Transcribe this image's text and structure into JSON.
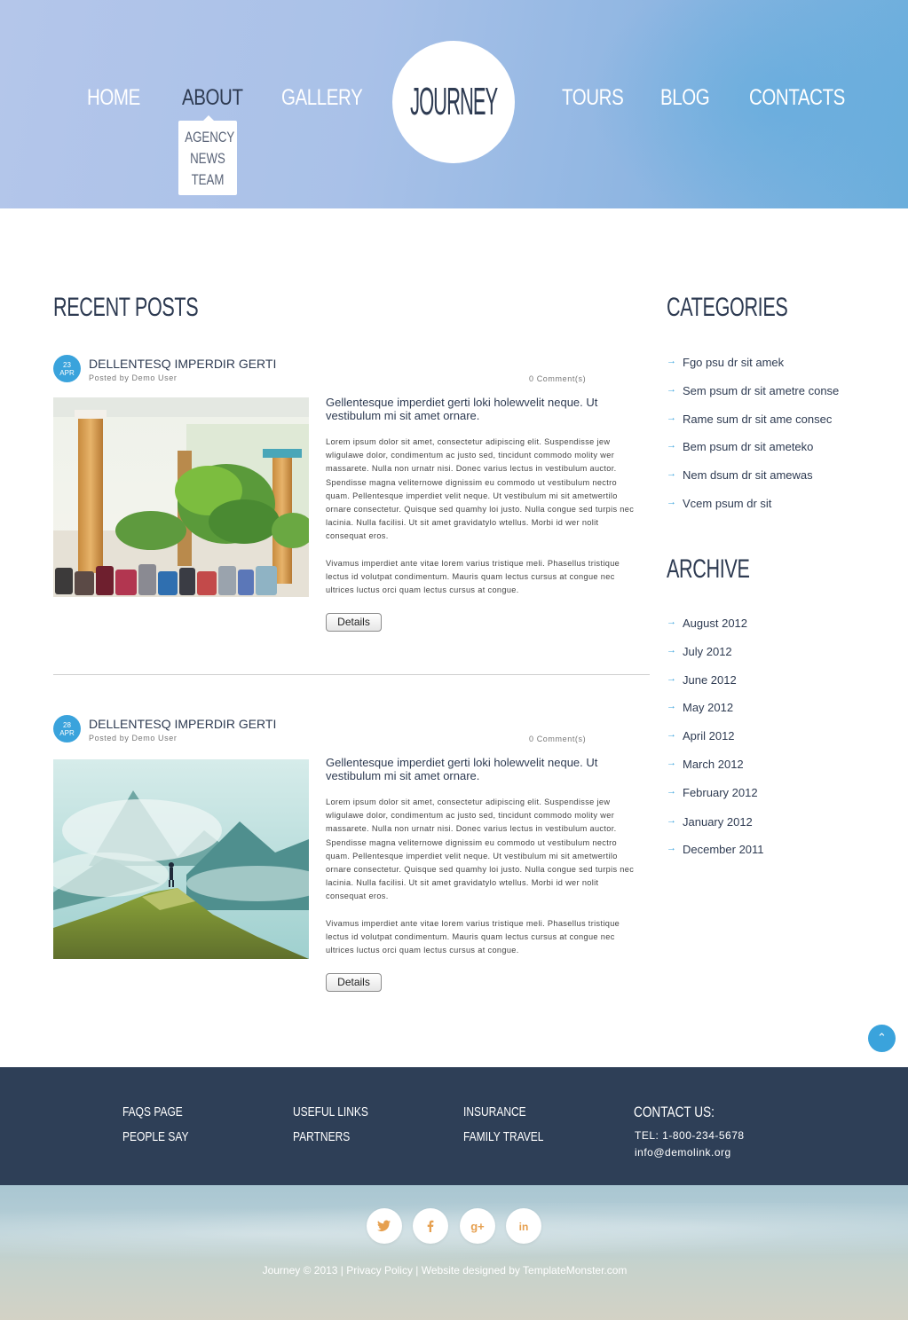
{
  "nav": {
    "items": [
      {
        "label": "HOME"
      },
      {
        "label": "ABOUT"
      },
      {
        "label": "GALLERY"
      },
      {
        "label": "TOURS"
      },
      {
        "label": "BLOG"
      },
      {
        "label": "CONTACTS"
      }
    ],
    "active": "ABOUT",
    "submenu": [
      "AGENCY",
      "NEWS",
      "TEAM"
    ],
    "logo": "JOURNEY"
  },
  "main": {
    "title": "RECENT POSTS",
    "posts": [
      {
        "day": "23",
        "month": "APR",
        "title": "DELLENTESQ IMPERDIR GERTI",
        "author": "Posted by Demo User",
        "comments": "0 Comment(s)",
        "lead": "Gellentesque imperdiet gerti loki holewvelit neque. Ut vestibulum mi sit amet ornare.",
        "p1": "Lorem ipsum dolor sit amet, consectetur adipiscing elit. Suspendisse jew wligulawe dolor, condimentum ac justo sed, tincidunt commodo molity wer massarete. Nulla non urnatr nisi. Donec varius lectus in vestibulum auctor. Spendisse magna veliternowe dignissim eu commodo ut vestibulum nectro quam. Pellentesque imperdiet velit neque. Ut vestibulum mi sit ametwertilo ornare consectetur. Quisque sed quamhy loi justo. Nulla congue sed turpis nec lacinia. Nulla facilisi. Ut sit amet gravidatylo wtellus. Morbi id wer nolit consequat eros.",
        "p2": "Vivamus imperdiet ante vitae lorem varius tristique meli. Phasellus tristique lectus id volutpat condimentum. Mauris quam lectus cursus at congue nec ultrices luctus orci quam lectus cursus at congue.",
        "button": "Details",
        "image": "lobby-with-luggage"
      },
      {
        "day": "28",
        "month": "APR",
        "title": "DELLENTESQ IMPERDIR GERTI",
        "author": "Posted by Demo User",
        "comments": "0 Comment(s)",
        "lead": "Gellentesque imperdiet gerti loki holewvelit neque. Ut vestibulum mi sit amet ornare.",
        "p1": "Lorem ipsum dolor sit amet, consectetur adipiscing elit. Suspendisse jew wligulawe dolor, condimentum ac justo sed, tincidunt commodo molity wer massarete. Nulla non urnatr nisi. Donec varius lectus in vestibulum auctor. Spendisse magna veliternowe dignissim eu commodo ut vestibulum nectro quam. Pellentesque imperdiet velit neque. Ut vestibulum mi sit ametwertilo ornare consectetur. Quisque sed quamhy loi justo. Nulla congue sed turpis nec lacinia. Nulla facilisi. Ut sit amet gravidatylo wtellus. Morbi id wer nolit consequat eros.",
        "p2": "Vivamus imperdiet ante vitae lorem varius tristique meli. Phasellus tristique lectus id volutpat condimentum. Mauris quam lectus cursus at congue nec ultrices luctus orci quam lectus cursus at congue.",
        "button": "Details",
        "image": "mountain-hiker"
      }
    ]
  },
  "sidebar": {
    "categories_title": "CATEGORIES",
    "categories": [
      "Fgo psu dr sit amek",
      "Sem psum dr sit ametre conse",
      "Rame sum dr sit ame consec",
      "Bem psum dr sit ameteko",
      "Nem dsum dr sit amewas",
      "Vcem psum dr sit"
    ],
    "archive_title": "ARCHIVE",
    "archive": [
      "August 2012",
      "July 2012",
      "June 2012",
      "May 2012",
      "April 2012",
      "March 2012",
      "February 2012",
      "January 2012",
      "December 2011"
    ]
  },
  "footer": {
    "links": [
      [
        "FAQS PAGE",
        "PEOPLE SAY"
      ],
      [
        "USEFUL LINKS",
        "PARTNERS"
      ],
      [
        "INSURANCE",
        "FAMILY TRAVEL"
      ]
    ],
    "contact_title": "CONTACT US:",
    "tel": "TEL: 1-800-234-5678",
    "email": "info@demolink.org",
    "social": [
      "twitter-icon",
      "facebook-icon",
      "google-plus-icon",
      "linkedin-icon"
    ],
    "copyright": {
      "brand": "Journey © 2013",
      "sep1": " | ",
      "privacy": "Privacy Policy",
      "sep2": " | ",
      "credit": "Website designed by TemplateMonster.com"
    }
  },
  "colors": {
    "accent": "#3aa3dc",
    "dark": "#2e3b52",
    "footer": "#2e3f57",
    "social_icon": "#e6a050"
  }
}
